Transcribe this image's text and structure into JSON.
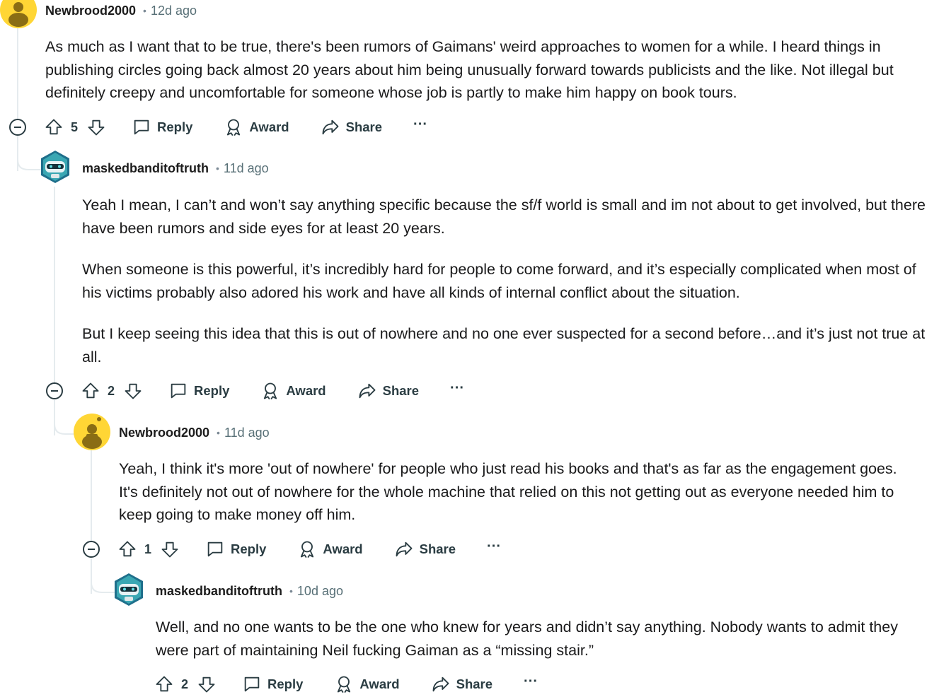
{
  "comments": [
    {
      "username": "Newbrood2000",
      "time": "12d ago",
      "avatar_icon": "snoo-avatar-icon",
      "paragraphs": [
        "As much as I want that to be true, there's been rumors of Gaimans' weird approaches to women for a while. I heard things in publishing circles going back almost 20 years about him being unusually forward towards publicists and the like. Not illegal but definitely creepy and uncomfortable for someone whose job is partly to make him happy on book tours."
      ],
      "votes": "5"
    },
    {
      "username": "maskedbanditoftruth",
      "time": "11d ago",
      "avatar_icon": "masked-bandit-avatar-icon",
      "paragraphs": [
        "Yeah I mean, I can’t and won’t say anything specific because the sf/f world is small and im not about to get involved, but there have been rumors and side eyes for at least 20 years.",
        "When someone is this powerful, it’s incredibly hard for people to come forward, and it’s especially complicated when most of his victims probably also adored his work and have all kinds of internal conflict about the situation.",
        "But I keep seeing this idea that this is out of nowhere and no one ever suspected for a second before…and it’s just not true at all."
      ],
      "votes": "2"
    },
    {
      "username": "Newbrood2000",
      "time": "11d ago",
      "avatar_icon": "snoo-avatar-icon",
      "paragraphs": [
        "Yeah, I think it's more 'out of nowhere' for people who just read his books and that's as far as the engagement goes. It's definitely not out of nowhere for the whole machine that relied on this not getting out as everyone needed him to keep going to make money off him."
      ],
      "votes": "1"
    },
    {
      "username": "maskedbanditoftruth",
      "time": "10d ago",
      "avatar_icon": "masked-bandit-avatar-icon",
      "paragraphs": [
        "Well, and no one wants to be the one who knew for years and didn’t say anything. Nobody wants to admit they were part of maintaining Neil fucking Gaiman as a “missing stair.”"
      ],
      "votes": "2"
    }
  ],
  "actions": {
    "reply": "Reply",
    "award": "Award",
    "share": "Share",
    "more": "···"
  },
  "colors": {
    "snoo_yellow": "#ffd635",
    "thread_line": "#e5ebee",
    "meta_gray": "#576f76",
    "action_text": "#2a3c42"
  }
}
